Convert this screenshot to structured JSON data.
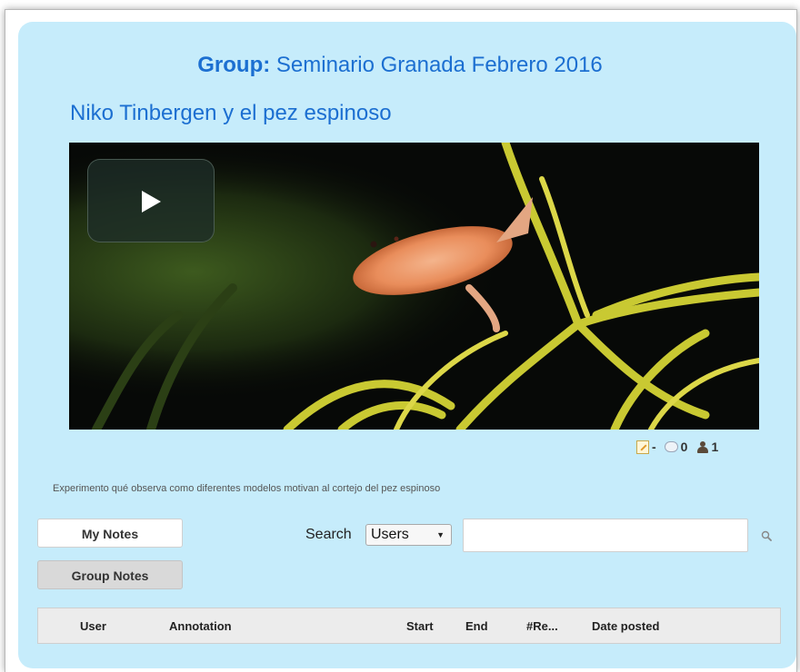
{
  "group": {
    "label": "Group:",
    "name": " Seminario Granada Febrero 2016"
  },
  "video": {
    "title": "Niko Tinbergen y el pez espinoso",
    "annotation_count": "-",
    "comment_count": "0",
    "user_count": "1",
    "description": "Experimento qué observa como diferentes modelos motivan al cortejo del pez espinoso"
  },
  "notes": {
    "my_notes": "My Notes",
    "group_notes": "Group Notes"
  },
  "search": {
    "label": "Search",
    "selected": "Users",
    "value": ""
  },
  "table": {
    "headers": [
      "User",
      "Annotation",
      "Start",
      "End",
      "#Re...",
      "Date posted"
    ]
  },
  "colors": {
    "panel": "#c6ecfb",
    "link": "#1c6fd1"
  }
}
